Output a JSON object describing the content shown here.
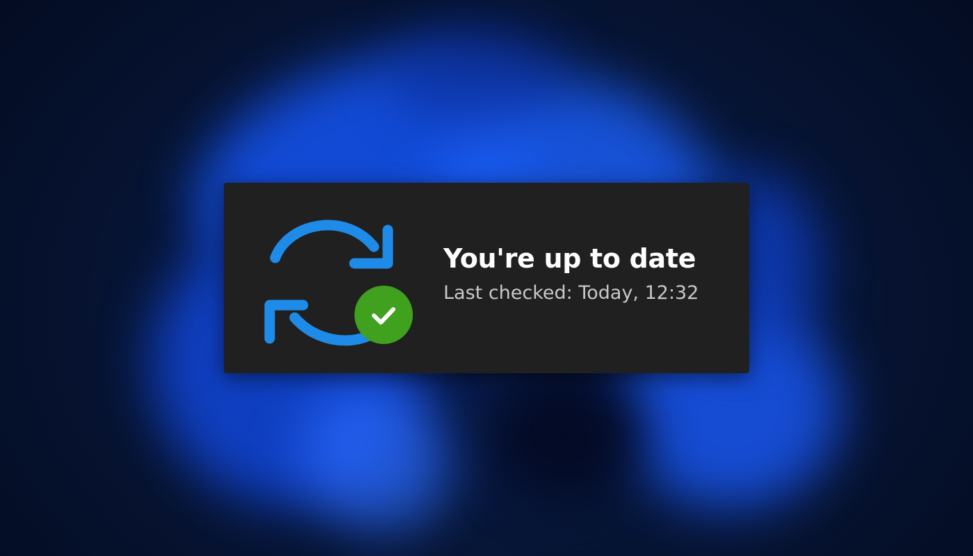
{
  "status": {
    "title": "You're up to date",
    "subtitle": "Last checked: Today, 12:32"
  },
  "icons": {
    "sync": "sync-arrows-icon",
    "badge": "checkmark-badge-icon"
  },
  "colors": {
    "card_background": "#202020",
    "sync_blue": "#1f8be8",
    "badge_green": "#3fa11d",
    "title_text": "#ffffff",
    "subtitle_text": "#c9c9c9",
    "wallpaper_blue": "#1450e6"
  }
}
